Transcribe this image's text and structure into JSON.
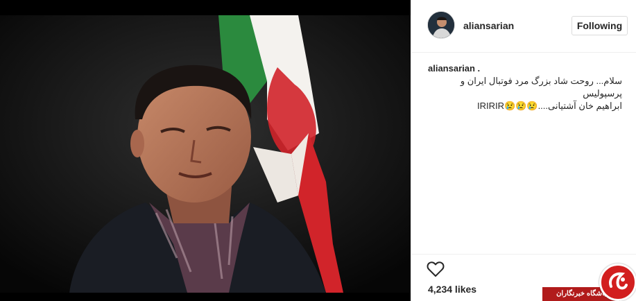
{
  "post": {
    "username": "aliansarian",
    "follow_label": "Following",
    "caption_username": "aliansarian .",
    "caption_line1": "سلام... روحت شاد بزرگ مرد فوتبال ایران و پرسپولیس",
    "caption_line2": "ابراهیم خان آشتیانی....😢😢😢IRIRIR",
    "likes": "4,234 likes"
  },
  "watermark": {
    "text": "باشگاه خبرنگاران"
  },
  "colors": {
    "flag_green": "#2b8a3e",
    "flag_red": "#d1242a",
    "watermark_red": "#b11b1b"
  },
  "icons": {
    "like": "heart-outline-icon",
    "watermark_logo": "yjc-logo-icon"
  }
}
